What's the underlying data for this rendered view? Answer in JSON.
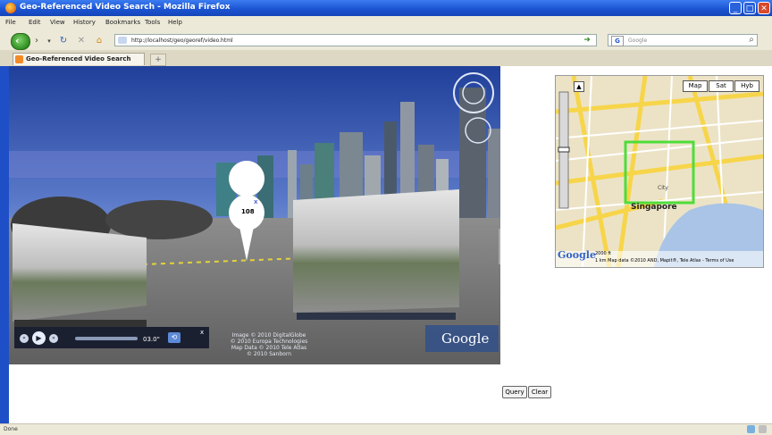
{
  "window": {
    "title": "Geo-Referenced Video Search - Mozilla Firefox",
    "controls": [
      "_",
      "□",
      "✕"
    ]
  },
  "menu": [
    "File",
    "Edit",
    "View",
    "History",
    "Bookmarks",
    "Tools",
    "Help"
  ],
  "navigation": {
    "url": "http://localhost/geo/georef/video.html",
    "search_placeholder": "Google",
    "search_engine_letter": "G"
  },
  "tabs": [
    {
      "label": "Geo-Referenced Video Search"
    }
  ],
  "earth_view": {
    "marker_label": "108",
    "marker_close": "x",
    "player_time": "03.0\"",
    "copyright_lines": [
      "Image © 2010 DigitalGlobe",
      "© 2010 Europa Technologies",
      "Map Data © 2010 Tele Atlas",
      "© 2010 Sanborn"
    ],
    "google_logo": "Google"
  },
  "minimap": {
    "map_types": [
      "Map",
      "Sat",
      "Hyb"
    ],
    "city_label": "Singapore",
    "district_label": "City",
    "google_logo": "Google",
    "scale_label": "2000 ft",
    "footer_text": "1 km   Map data ©2010 AND, Mapit®, Tele Atlas - Terms of Use"
  },
  "buttons": {
    "query": "Query",
    "clear": "Clear"
  },
  "status": {
    "text": "Done"
  },
  "colors": {
    "titlebar": "#1a52d0",
    "chrome": "#ece9d8",
    "highlight_box": "#4fdc3a",
    "sidebar_stripe": "#1e4fc7"
  }
}
